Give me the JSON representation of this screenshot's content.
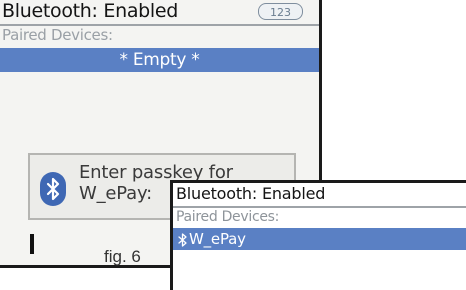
{
  "back_screen": {
    "title": "Bluetooth: Enabled",
    "badge": "123",
    "paired_label": "Paired Devices:",
    "selected_item": "* Empty *",
    "dialog": {
      "line1": "Enter passkey for",
      "line2": "W_ePay:",
      "icon": "bluetooth-icon"
    }
  },
  "caption": "fig. 6",
  "front_screen": {
    "title": "Bluetooth: Enabled",
    "paired_label": "Paired Devices:",
    "selected_item": "W_ePay",
    "item_icon": "bluetooth-icon"
  },
  "colors": {
    "highlight": "#5a80c4",
    "bluetooth_badge": "#3f68b4"
  }
}
